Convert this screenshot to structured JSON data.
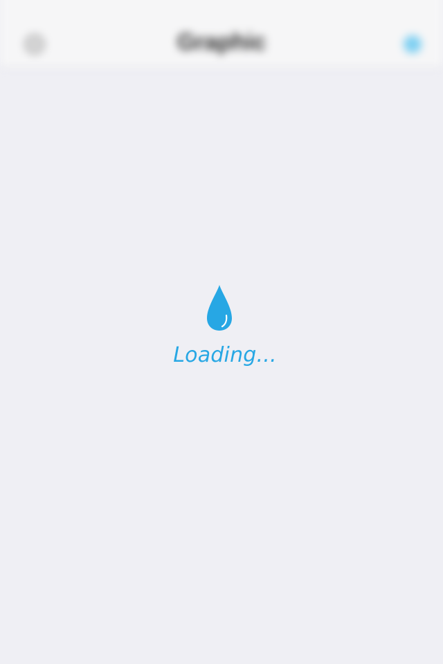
{
  "nav": {
    "title": "Graphic",
    "left_icon": "gear-icon",
    "right_icon": "bluetooth-icon"
  },
  "loading": {
    "text": "Loading...",
    "icon": "water-drop-icon"
  },
  "tabs": [
    {
      "label": "",
      "icon": "home-icon",
      "active": true
    },
    {
      "label": "",
      "icon": "chart-icon",
      "active": false
    },
    {
      "label": "",
      "icon": "history-icon",
      "active": false
    },
    {
      "label": "",
      "icon": "cup-icon",
      "active": false
    },
    {
      "label": "",
      "icon": "more-icon",
      "active": false
    }
  ],
  "colors": {
    "accent": "#27a7e4",
    "background": "#efeff4"
  }
}
